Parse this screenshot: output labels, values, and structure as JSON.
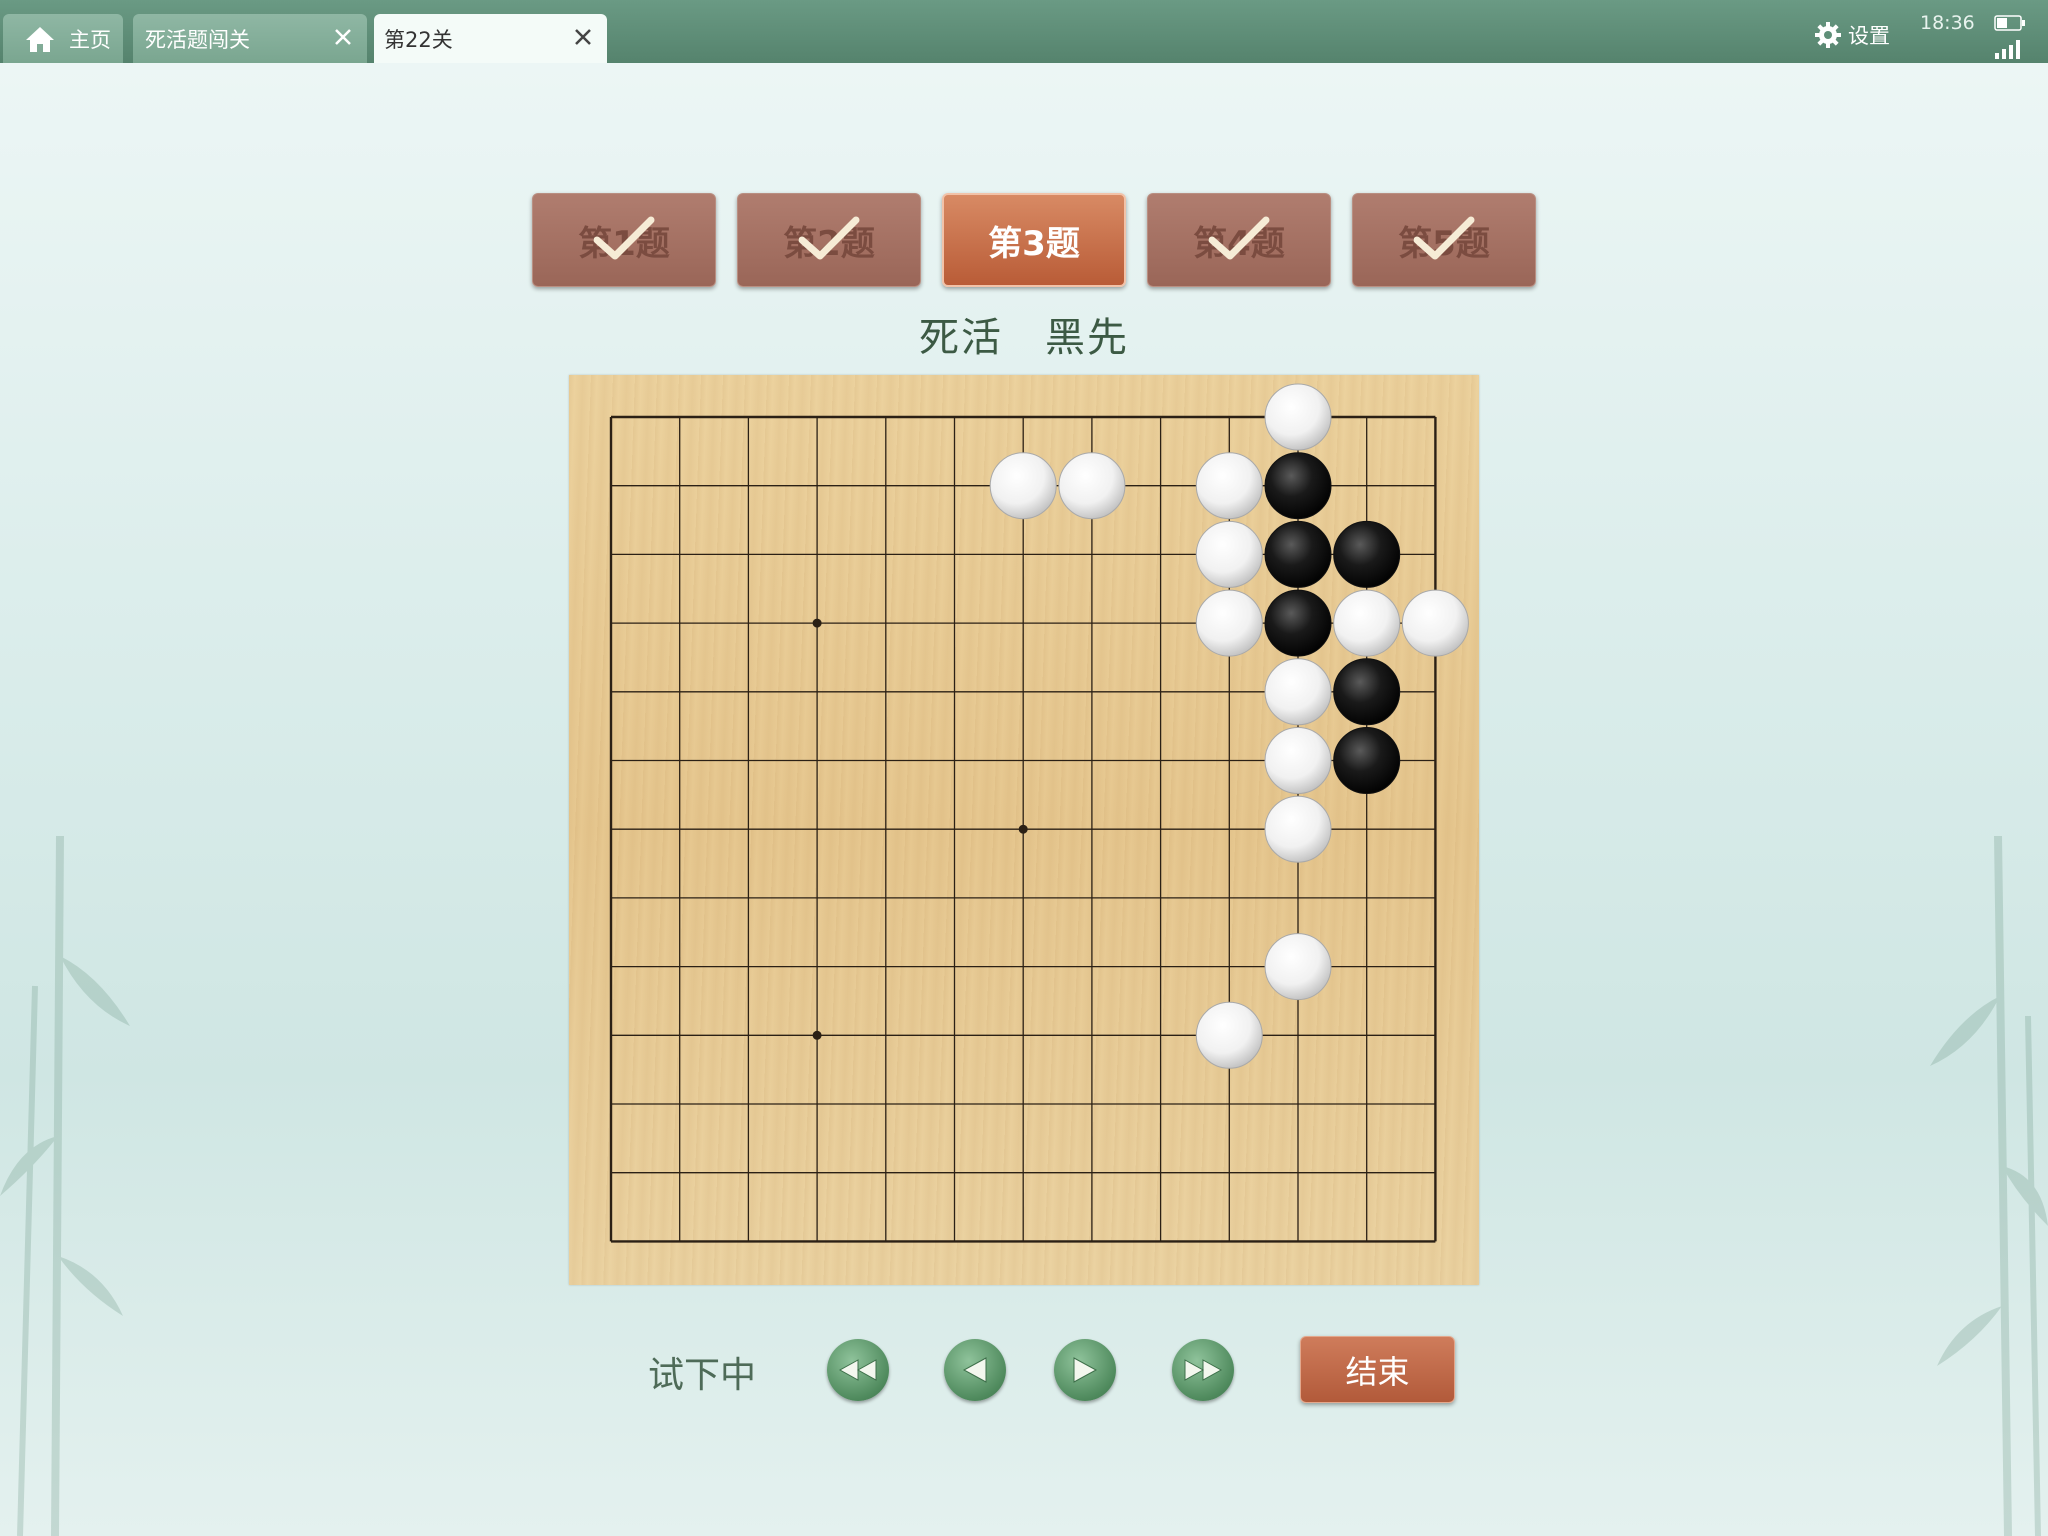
{
  "tabs": [
    {
      "label": "主页",
      "icon": "home-icon",
      "closable": false
    },
    {
      "label": "死活题闯关",
      "closable": true
    },
    {
      "label": "第22关",
      "closable": true,
      "active": true
    }
  ],
  "status": {
    "settings_label": "设置",
    "time": "18:36"
  },
  "problems": [
    {
      "label": "第1题",
      "completed": true
    },
    {
      "label": "第2题",
      "completed": true
    },
    {
      "label": "第3题",
      "completed": false,
      "current": true
    },
    {
      "label": "第4题",
      "completed": true
    },
    {
      "label": "第5题",
      "completed": true
    }
  ],
  "subtitle": "死活　黑先",
  "board": {
    "size": 13,
    "star_points": [
      [
        3,
        3
      ],
      [
        3,
        9
      ],
      [
        6,
        6
      ]
    ],
    "black_stones": [
      [
        10,
        1
      ],
      [
        10,
        2
      ],
      [
        11,
        2
      ],
      [
        10,
        3
      ],
      [
        11,
        4
      ],
      [
        11,
        5
      ]
    ],
    "white_stones": [
      [
        10,
        0
      ],
      [
        6,
        1
      ],
      [
        7,
        1
      ],
      [
        9,
        1
      ],
      [
        9,
        2
      ],
      [
        9,
        3
      ],
      [
        11,
        3
      ],
      [
        12,
        3
      ],
      [
        10,
        4
      ],
      [
        10,
        5
      ],
      [
        10,
        6
      ],
      [
        10,
        8
      ],
      [
        9,
        9
      ]
    ]
  },
  "controls": {
    "status_text": "试下中",
    "first_icon": "rewind-to-start-icon",
    "prev_icon": "step-back-icon",
    "next_icon": "step-forward-icon",
    "last_icon": "fast-forward-to-end-icon",
    "end_label": "结束"
  },
  "colors": {
    "topbar": "#5f8f78",
    "done_button": "#a06d5f",
    "current_button": "#c4653f",
    "end_button": "#c06a48",
    "nav_button": "#5a9468",
    "board": "#e8cb93"
  }
}
